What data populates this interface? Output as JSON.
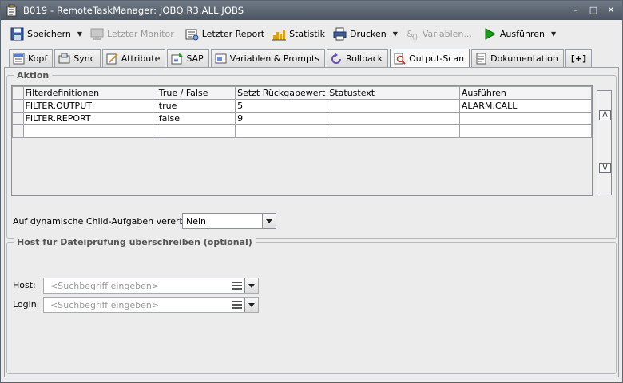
{
  "window": {
    "title": "B019 - RemoteTaskManager: JOBQ.R3.ALL.JOBS",
    "minimize": "–",
    "maximize": "□",
    "close": "✕"
  },
  "toolbar": {
    "save": "Speichern",
    "last_monitor": "Letzter Monitor",
    "last_report": "Letzter Report",
    "statistics": "Statistik",
    "print": "Drucken",
    "variables": "Variablen...",
    "execute": "Ausführen"
  },
  "tabs": [
    {
      "label": "Kopf",
      "icon": "header-icon"
    },
    {
      "label": "Sync",
      "icon": "sync-icon"
    },
    {
      "label": "Attribute",
      "icon": "attribute-icon"
    },
    {
      "label": "SAP",
      "icon": "sap-icon"
    },
    {
      "label": "Variablen & Prompts",
      "icon": "variables-icon"
    },
    {
      "label": "Rollback",
      "icon": "rollback-icon"
    },
    {
      "label": "Output-Scan",
      "icon": "output-scan-icon",
      "active": true
    },
    {
      "label": "Dokumentation",
      "icon": "documentation-icon"
    },
    {
      "label": "[+]",
      "icon": "add-tab-icon"
    }
  ],
  "action_group": {
    "legend": "Aktion",
    "columns": [
      "Filterdefinitionen",
      "True / False",
      "Setzt Rückgabewert",
      "Statustext",
      "Ausführen"
    ],
    "rows": [
      [
        "FILTER.OUTPUT",
        "true",
        "5",
        "",
        "ALARM.CALL"
      ],
      [
        "FILTER.REPORT",
        "false",
        "9",
        "",
        ""
      ],
      [
        "",
        "",
        "",
        "",
        ""
      ]
    ],
    "move_up": "/\\",
    "move_down": "\\/"
  },
  "inherit": {
    "label": "Auf dynamische Child-Aufgaben vererben:",
    "value": "Nein"
  },
  "host_group": {
    "legend": "Host für Dateiprüfung überschreiben (optional)",
    "host_label": "Host:",
    "host_placeholder": "<Suchbegriff eingeben>",
    "login_label": "Login:",
    "login_placeholder": "<Suchbegriff eingeben>"
  },
  "colors": {
    "titlebar": "#4c5560",
    "play": "#1a9a1a"
  }
}
